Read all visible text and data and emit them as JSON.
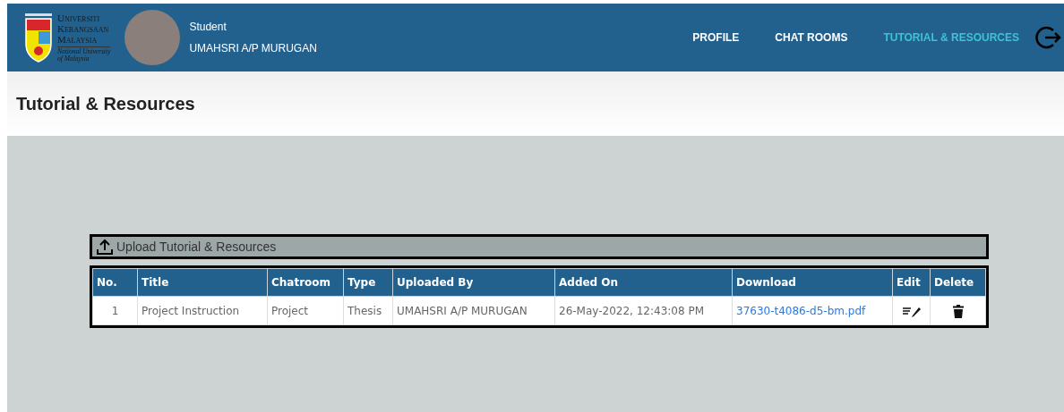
{
  "header": {
    "logo": {
      "lines": [
        "Universiti",
        "Kebangsaan",
        "Malaysia"
      ],
      "subtitle": [
        "National University",
        "of Malaysia"
      ]
    },
    "user": {
      "role": "Student",
      "name": "UMAHSRI A/P MURUGAN"
    },
    "nav": [
      {
        "label": "PROFILE",
        "selected": false
      },
      {
        "label": "CHAT ROOMS",
        "selected": false
      },
      {
        "label": "TUTORIAL & RESOURCES",
        "selected": true
      }
    ]
  },
  "page_title": "Tutorial & Resources",
  "upload_bar": {
    "label": "Upload Tutorial & Resources"
  },
  "table": {
    "columns": [
      "No.",
      "Title",
      "Chatroom",
      "Type",
      "Uploaded By",
      "Added On",
      "Download",
      "Edit",
      "Delete"
    ],
    "rows": [
      {
        "no": "1",
        "title": "Project Instruction",
        "chatroom": "Project",
        "type": "Thesis",
        "uploaded_by": "UMAHSRI A/P MURUGAN",
        "added_on": "26-May-2022, 12:43:08 PM",
        "download": "37630-t4086-d5-bm.pdf"
      }
    ]
  }
}
